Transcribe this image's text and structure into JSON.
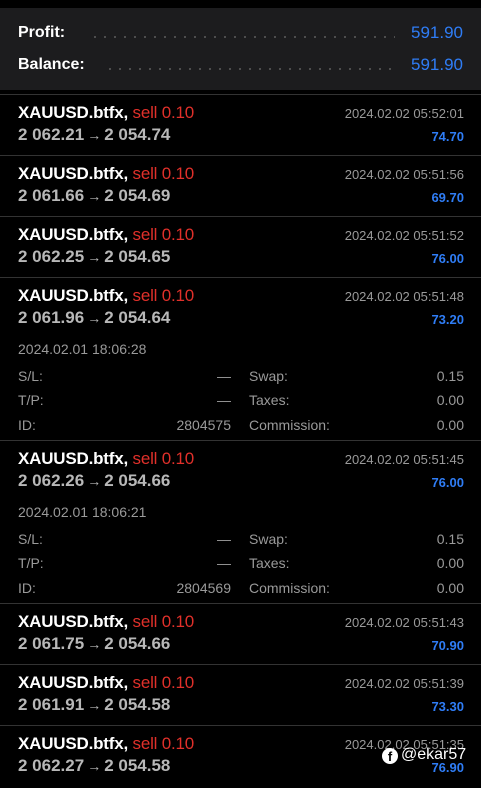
{
  "summary": {
    "profit_label": "Profit:",
    "profit_value": "591.90",
    "balance_label": "Balance:",
    "balance_value": "591.90"
  },
  "deals": [
    {
      "symbol": "XAUUSD.btfx,",
      "side": "sell 0.10",
      "open_price": "2 062.21",
      "arrow": "→",
      "close_price": "2 054.74",
      "time": "2024.02.02 05:52:01",
      "profit": "74.70"
    },
    {
      "symbol": "XAUUSD.btfx,",
      "side": "sell 0.10",
      "open_price": "2 061.66",
      "arrow": "→",
      "close_price": "2 054.69",
      "time": "2024.02.02 05:51:56",
      "profit": "69.70"
    },
    {
      "symbol": "XAUUSD.btfx,",
      "side": "sell 0.10",
      "open_price": "2 062.25",
      "arrow": "→",
      "close_price": "2 054.65",
      "time": "2024.02.02 05:51:52",
      "profit": "76.00"
    },
    {
      "symbol": "XAUUSD.btfx,",
      "side": "sell 0.10",
      "open_price": "2 061.96",
      "arrow": "→",
      "close_price": "2 054.64",
      "time": "2024.02.02 05:51:48",
      "profit": "73.20",
      "details": {
        "open_time": "2024.02.01 18:06:28",
        "sl_label": "S/L:",
        "sl_value": "—",
        "tp_label": "T/P:",
        "tp_value": "—",
        "id_label": "ID:",
        "id_value": "2804575",
        "swap_label": "Swap:",
        "swap_value": "0.15",
        "taxes_label": "Taxes:",
        "taxes_value": "0.00",
        "commission_label": "Commission:",
        "commission_value": "0.00"
      }
    },
    {
      "symbol": "XAUUSD.btfx,",
      "side": "sell 0.10",
      "open_price": "2 062.26",
      "arrow": "→",
      "close_price": "2 054.66",
      "time": "2024.02.02 05:51:45",
      "profit": "76.00",
      "details": {
        "open_time": "2024.02.01 18:06:21",
        "sl_label": "S/L:",
        "sl_value": "—",
        "tp_label": "T/P:",
        "tp_value": "—",
        "id_label": "ID:",
        "id_value": "2804569",
        "swap_label": "Swap:",
        "swap_value": "0.15",
        "taxes_label": "Taxes:",
        "taxes_value": "0.00",
        "commission_label": "Commission:",
        "commission_value": "0.00"
      }
    },
    {
      "symbol": "XAUUSD.btfx,",
      "side": "sell 0.10",
      "open_price": "2 061.75",
      "arrow": "→",
      "close_price": "2 054.66",
      "time": "2024.02.02 05:51:43",
      "profit": "70.90"
    },
    {
      "symbol": "XAUUSD.btfx,",
      "side": "sell 0.10",
      "open_price": "2 061.91",
      "arrow": "→",
      "close_price": "2 054.58",
      "time": "2024.02.02 05:51:39",
      "profit": "73.30"
    },
    {
      "symbol": "XAUUSD.btfx,",
      "side": "sell 0.10",
      "open_price": "2 062.27",
      "arrow": "→",
      "close_price": "2 054.58",
      "time": "2024.02.02 05:51:35",
      "profit": "76.90"
    }
  ],
  "watermark": {
    "icon": "facebook-icon",
    "glyph": "f",
    "text": "@ekar57"
  },
  "colors": {
    "profit_blue": "#2f7df6",
    "sell_red": "#e0302a",
    "background": "#000000",
    "summary_bg": "#1c1c1e"
  }
}
